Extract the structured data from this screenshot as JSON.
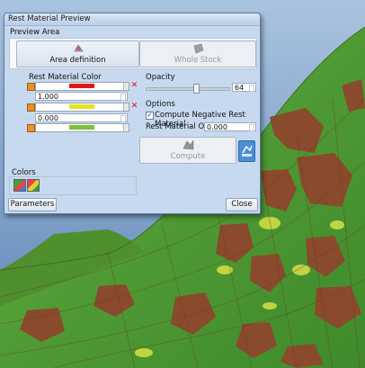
{
  "dialog": {
    "title": "Rest Material Preview",
    "preview_area_label": "Preview Area",
    "area_definition_label": "Area definition",
    "whole_stock_label": "Whole Stock",
    "rest_material_color_label": "Rest Material Color",
    "opacity_label": "Opacity",
    "opacity_value": "64",
    "options_label": "Options",
    "compute_negative_label": "Compute Negative Rest Material",
    "compute_negative_checked": true,
    "offset_label": "Rest Material Offset",
    "offset_value": "0.000",
    "compute_label": "Compute",
    "colors_label": "Colors",
    "parameters_label": "Parameters",
    "close_label": "Close",
    "color_rows": [
      {
        "color": "#e01818",
        "value": "1.000"
      },
      {
        "color": "#e8e21c",
        "value": "0.000"
      },
      {
        "color": "#7ac23a"
      }
    ]
  },
  "colors": {
    "accent": "#4a8fd6",
    "dialog_bg": "#c7d9ee",
    "terrain_green": "#5aa83a",
    "terrain_brown": "#8b4a2a"
  }
}
